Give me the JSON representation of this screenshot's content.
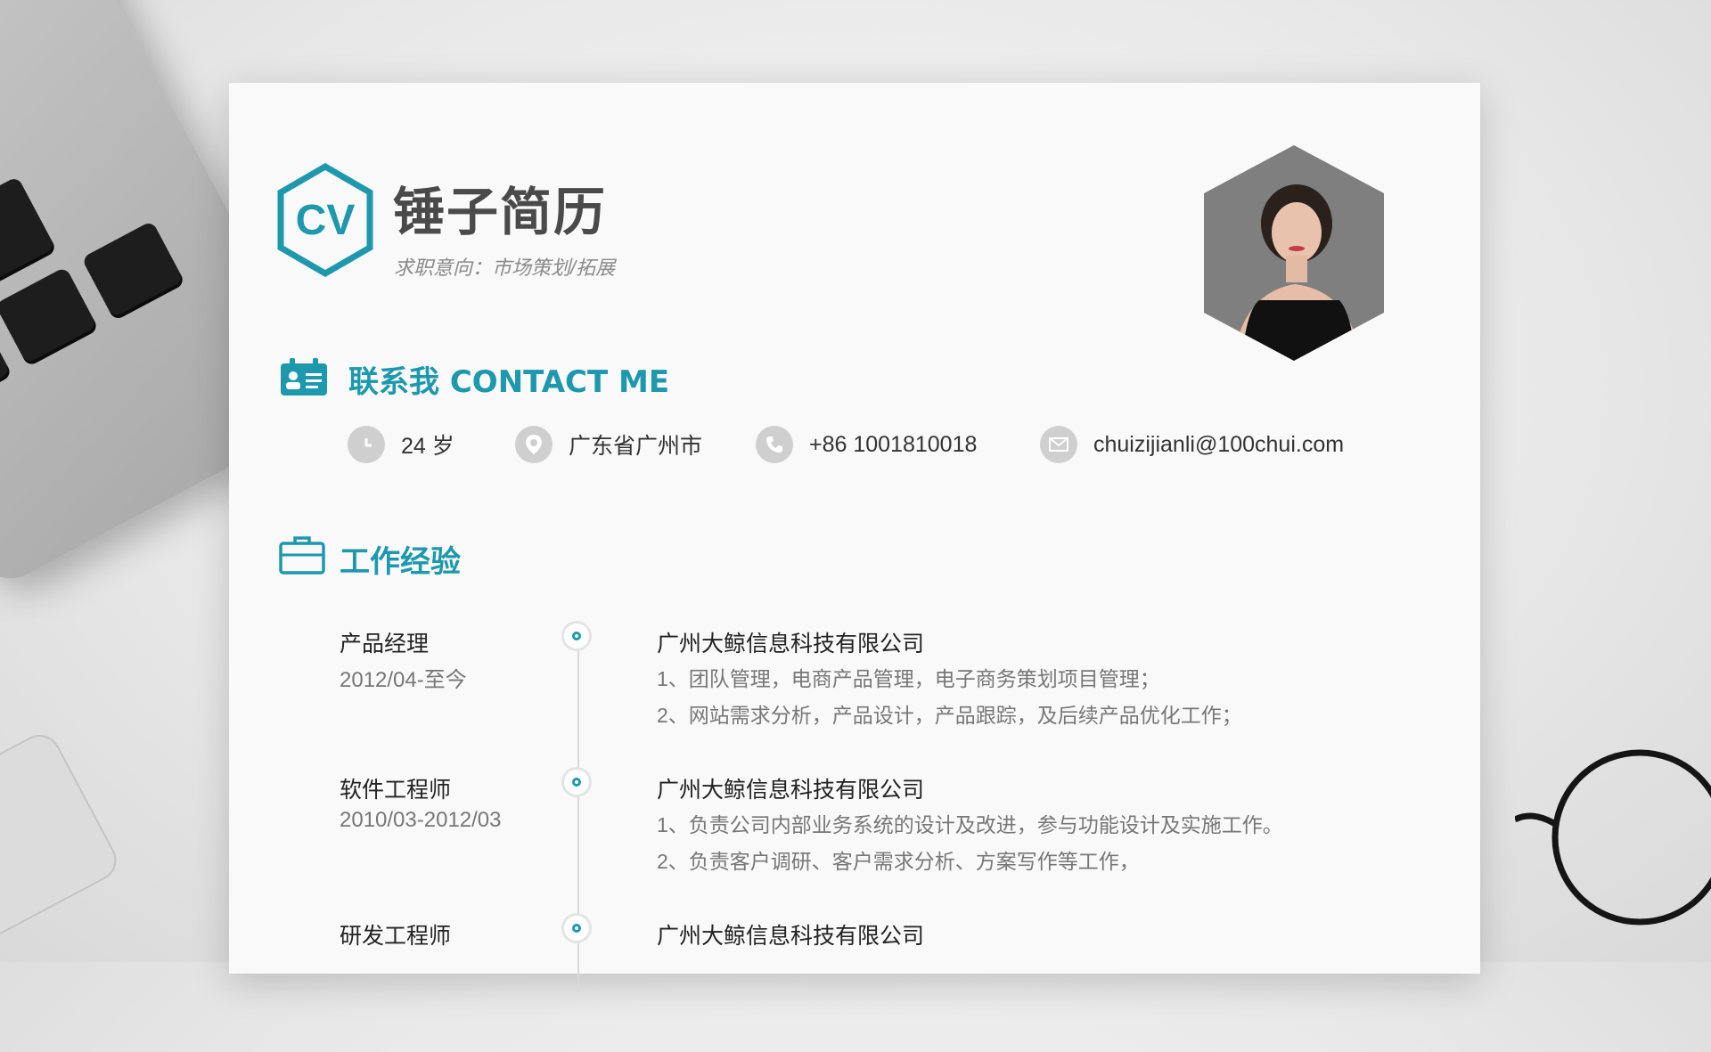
{
  "header": {
    "logo_text": "CV",
    "name": "锤子简历",
    "intent": "求职意向：市场策划/拓展"
  },
  "contact": {
    "title": "联系我 CONTACT ME",
    "items": [
      {
        "icon": "clock-icon",
        "text": "24 岁"
      },
      {
        "icon": "location-pin-icon",
        "text": "广东省广州市"
      },
      {
        "icon": "phone-icon",
        "text": "+86 1001810018"
      },
      {
        "icon": "mail-icon",
        "text": "chuizijianli@100chui.com"
      }
    ]
  },
  "experience": {
    "title": "工作经验",
    "jobs": [
      {
        "title": "产品经理",
        "date": "2012/04-至今",
        "company": "广州大鲸信息科技有限公司",
        "duties": [
          "1、团队管理，电商产品管理，电子商务策划项目管理；",
          "2、网站需求分析，产品设计，产品跟踪，及后续产品优化工作；"
        ]
      },
      {
        "title": "软件工程师",
        "date": "2010/03-2012/03",
        "company": "广州大鲸信息科技有限公司",
        "duties": [
          "1、负责公司内部业务系统的设计及改进，参与功能设计及实施工作。",
          "2、负责客户调研、客户需求分析、方案写作等工作，"
        ]
      },
      {
        "title": "研发工程师",
        "date": "",
        "company": "广州大鲸信息科技有限公司",
        "duties": []
      }
    ]
  },
  "colors": {
    "accent": "#1d98ad",
    "heading": "#4a4a4a",
    "icon_bg": "#cfcfcf"
  }
}
